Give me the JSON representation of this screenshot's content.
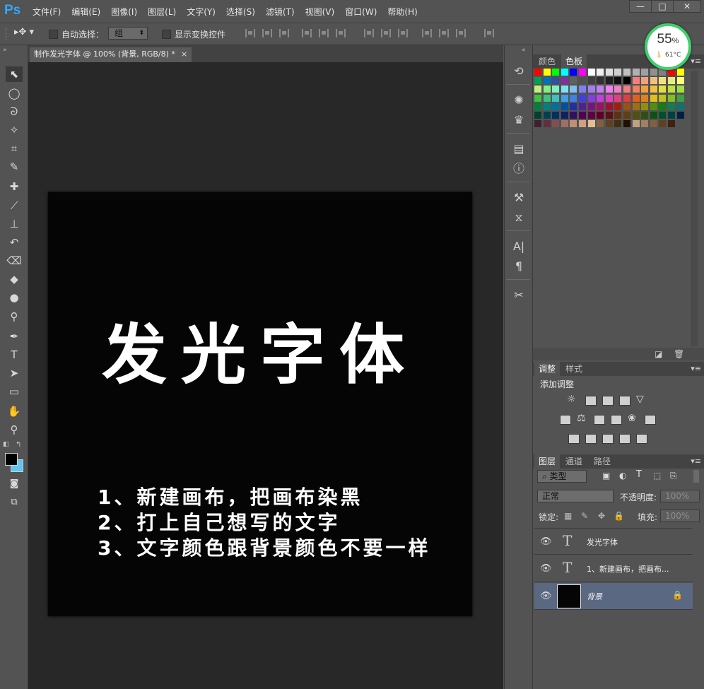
{
  "app": {
    "logo": "Ps"
  },
  "menu": [
    "文件(F)",
    "编辑(E)",
    "图像(I)",
    "图层(L)",
    "文字(Y)",
    "选择(S)",
    "滤镜(T)",
    "视图(V)",
    "窗口(W)",
    "帮助(H)"
  ],
  "window_controls": {
    "minimize": "—",
    "maximize": "□",
    "close": "✕"
  },
  "options_bar": {
    "auto_select_label": "自动选择：",
    "auto_select_value": "组",
    "show_transform_label": "显示变换控件"
  },
  "document": {
    "tab_title": "制作发光字体 @ 100% (背景, RGB/8) *",
    "tab_close": "×",
    "canvas_title": "发光字体",
    "lines": [
      "1、新建画布，把画布染黑",
      "2、打上自己想写的文字",
      "3、文字颜色跟背景颜色不要一样"
    ]
  },
  "panels": {
    "color_tabs": [
      "颜色",
      "色板"
    ],
    "adjust_tabs": [
      "调整",
      "样式"
    ],
    "adjust_label": "添加调整",
    "layers_tabs": [
      "图层",
      "通道",
      "路径"
    ],
    "filter_kind": "类型",
    "blend_mode": "正常",
    "opacity_label": "不透明度:",
    "opacity_value": "100%",
    "lock_label": "锁定:",
    "fill_label": "填充:",
    "fill_value": "100%",
    "menu_icon": "▾≡",
    "layers": [
      {
        "name": "发光字体",
        "type": "T"
      },
      {
        "name": "1、新建画布，把画布...",
        "type": "T"
      },
      {
        "name": "背景",
        "type": "image"
      }
    ]
  },
  "cpu_widget": {
    "percent": "55",
    "percent_sign": "%",
    "temp": "61°C"
  },
  "colors": {
    "accent": "#31a8ff",
    "cpu_ring": "#3fcf6d",
    "bg_swatch": "#5ec4f2",
    "selected_layer": "#5a6882"
  }
}
